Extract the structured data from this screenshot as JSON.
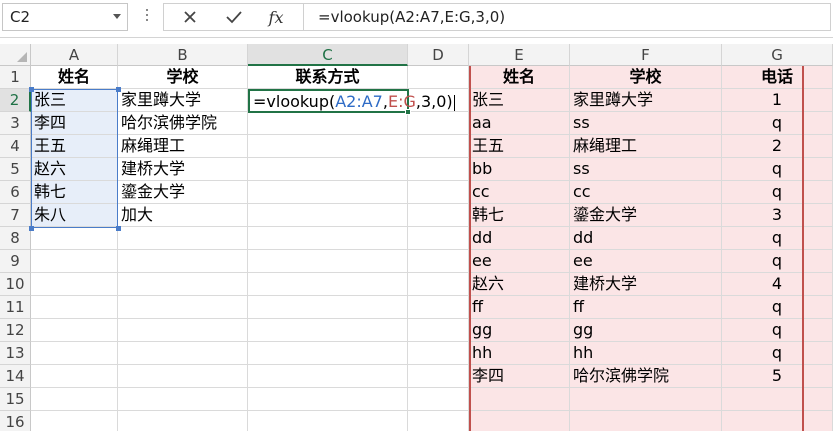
{
  "formula_bar": {
    "name_box": "C2",
    "fx_label": "fx",
    "formula": "=vlookup(A2:A7,E:G,3,0)"
  },
  "active_cell_edit": {
    "prefix": "=vlookup(",
    "ref1": "A2:A7",
    "sep1": ",",
    "ref2": "E:G",
    "suffix": ",3,0)"
  },
  "columns": [
    "A",
    "B",
    "C",
    "D",
    "E",
    "F",
    "G"
  ],
  "rows": [
    "1",
    "2",
    "3",
    "4",
    "5",
    "6",
    "7",
    "8",
    "9",
    "10",
    "11",
    "12",
    "13",
    "14",
    "15",
    "16"
  ],
  "left_table": {
    "headers": {
      "A": "姓名",
      "B": "学校",
      "C": "联系方式"
    },
    "names": [
      "张三",
      "李四",
      "王五",
      "赵六",
      "韩七",
      "朱八"
    ],
    "schools": [
      "家里蹲大学",
      "哈尔滨佛学院",
      "麻绳理工",
      "建桥大学",
      "鎏金大学",
      "加大"
    ]
  },
  "right_table": {
    "headers": {
      "E": "姓名",
      "F": "学校",
      "G": "电话"
    },
    "rows": [
      [
        "张三",
        "家里蹲大学",
        "1"
      ],
      [
        "aa",
        "ss",
        "q"
      ],
      [
        "王五",
        "麻绳理工",
        "2"
      ],
      [
        "bb",
        "ss",
        "q"
      ],
      [
        "cc",
        "cc",
        "q"
      ],
      [
        "韩七",
        "鎏金大学",
        "3"
      ],
      [
        "dd",
        "dd",
        "q"
      ],
      [
        "ee",
        "ee",
        "q"
      ],
      [
        "赵六",
        "建桥大学",
        "4"
      ],
      [
        "ff",
        "ff",
        "q"
      ],
      [
        "gg",
        "gg",
        "q"
      ],
      [
        "hh",
        "hh",
        "q"
      ],
      [
        "李四",
        "哈尔滨佛学院",
        "5"
      ],
      [
        "",
        "",
        ""
      ],
      [
        "",
        "",
        ""
      ]
    ]
  },
  "colors": {
    "accent_green": "#217346",
    "ref_blue": "#4a7cc9",
    "ref_red": "#c0504d",
    "blue_fill": "#e7eef9",
    "pink_fill": "#fbe5e6"
  }
}
